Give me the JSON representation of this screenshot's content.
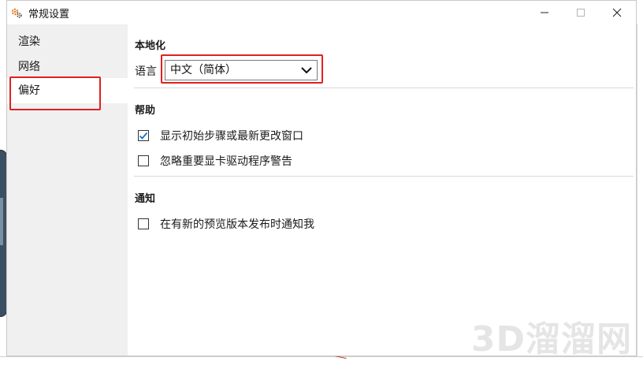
{
  "window": {
    "title": "常规设置",
    "icon": "gear-icon",
    "controls": {
      "minimize": "—",
      "maximize": "☐",
      "close": "✕"
    }
  },
  "nav": {
    "items": [
      {
        "label": "渲染",
        "selected": false
      },
      {
        "label": "网络",
        "selected": false
      },
      {
        "label": "偏好",
        "selected": true
      }
    ]
  },
  "localization": {
    "title": "本地化",
    "language_label": "语言",
    "language_value": "中文（简体）"
  },
  "help": {
    "title": "帮助",
    "options": [
      {
        "label": "显示初始步骤或最新更改窗口",
        "checked": true
      },
      {
        "label": "忽略重要显卡驱动程序警告",
        "checked": false
      }
    ]
  },
  "notifications": {
    "title": "通知",
    "options": [
      {
        "label": "在有新的预览版本发布时通知我",
        "checked": false
      }
    ]
  },
  "watermark": "3D溜溜网",
  "colors": {
    "highlight": "#e02020",
    "check": "#1a73c8",
    "nav_bg": "#f0f0f0"
  }
}
